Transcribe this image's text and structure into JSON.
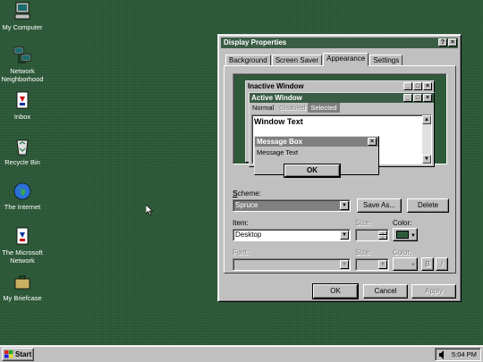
{
  "desktop": {
    "icons": [
      {
        "label": "My Computer",
        "icon": "computer-icon"
      },
      {
        "label": "Network Neighborhood",
        "icon": "network-icon"
      },
      {
        "label": "Inbox",
        "icon": "inbox-icon"
      },
      {
        "label": "Recycle Bin",
        "icon": "recycle-bin-icon"
      },
      {
        "label": "The Internet",
        "icon": "globe-icon"
      },
      {
        "label": "The Microsoft Network",
        "icon": "msn-icon"
      },
      {
        "label": "My Briefcase",
        "icon": "briefcase-icon"
      }
    ]
  },
  "dialog": {
    "title": "Display Properties",
    "help_btn": "?",
    "close_btn": "×",
    "tabs": [
      "Background",
      "Screen Saver",
      "Appearance",
      "Settings"
    ],
    "active_tab": "Appearance",
    "preview": {
      "inactive_title": "Inactive Window",
      "active_title": "Active Window",
      "menu_normal": "Normal",
      "menu_disabled": "Disabled",
      "menu_selected": "Selected",
      "window_text": "Window Text",
      "msgbox_title": "Message Box",
      "msgbox_text": "Message Text",
      "msgbox_ok": "OK"
    },
    "scheme_label": "Scheme:",
    "scheme_value": "Spruce",
    "save_as": "Save As...",
    "delete": "Delete",
    "item_label": "Item:",
    "item_value": "Desktop",
    "size_label": "Size:",
    "color_label": "Color:",
    "font_label": "Font:",
    "font_size_label": "Size:",
    "font_color_label": "Color:",
    "bold_btn": "B",
    "italic_btn": "I",
    "ok": "OK",
    "cancel": "Cancel",
    "apply": "Apply"
  },
  "taskbar": {
    "start": "Start",
    "time": "5:04 PM"
  },
  "colors": {
    "desktop": "#2f5b3a",
    "active_title": "#3b5c45",
    "inactive_title": "#c0c0c0",
    "selected_menu": "#808080"
  }
}
